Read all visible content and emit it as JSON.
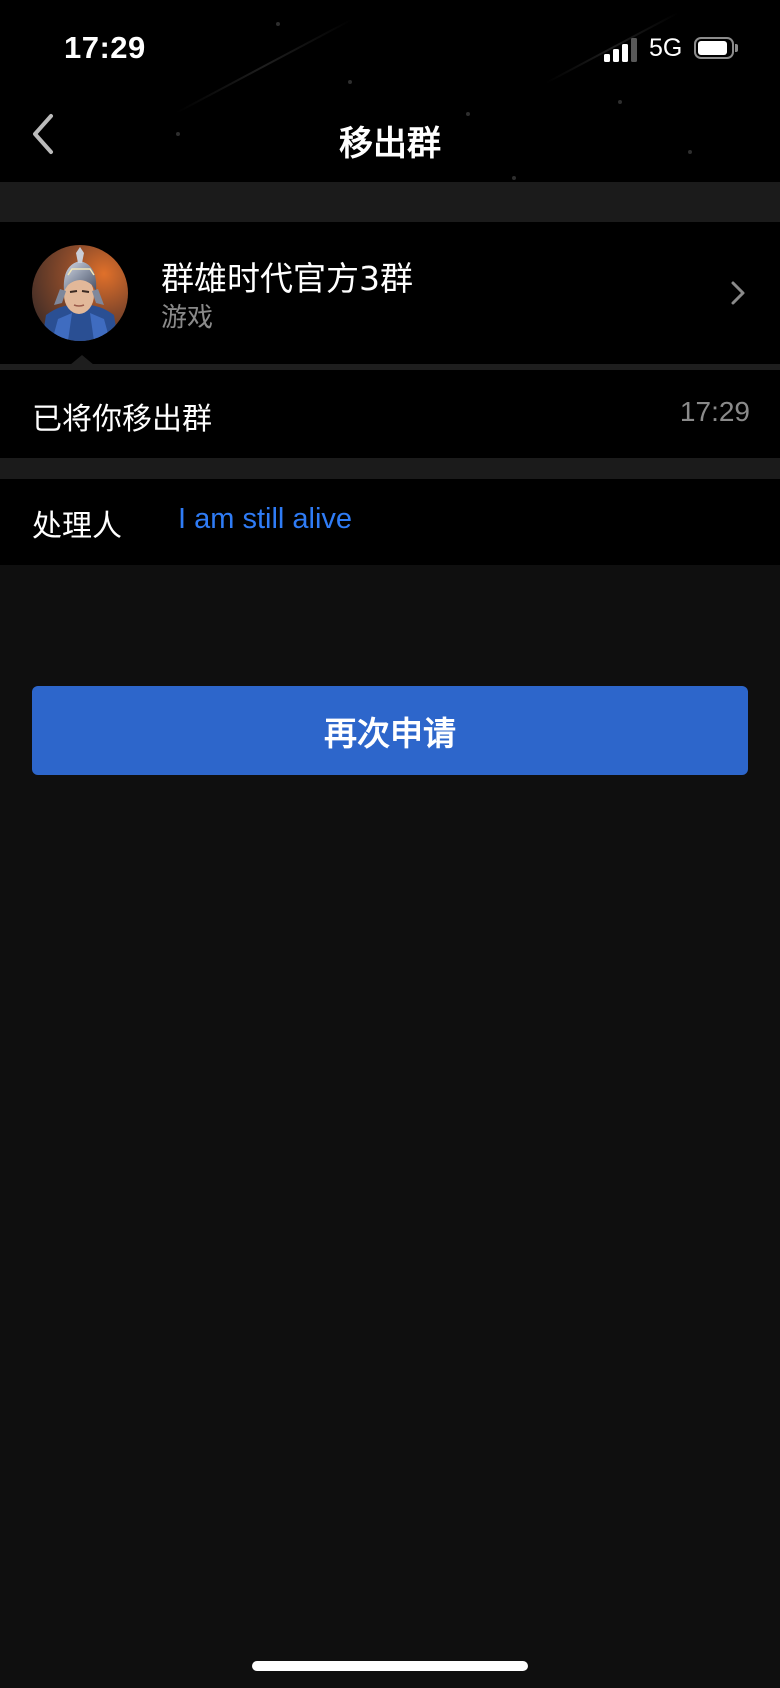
{
  "status_bar": {
    "time": "17:29",
    "network": "5G",
    "battery_level": 0.75,
    "signal_bars": 3
  },
  "nav": {
    "title": "移出群",
    "back_icon": "chevron-left-icon"
  },
  "group": {
    "name": "群雄时代官方3群",
    "category": "游戏",
    "avatar_icon": "group-avatar",
    "chevron_icon": "chevron-right-icon"
  },
  "notice": {
    "text": "已将你移出群",
    "time": "17:29"
  },
  "handler": {
    "label": "处理人",
    "name": "I am still alive",
    "name_color": "#2f7cf6"
  },
  "actions": {
    "reapply_label": "再次申请",
    "button_color": "#2d66cb"
  }
}
